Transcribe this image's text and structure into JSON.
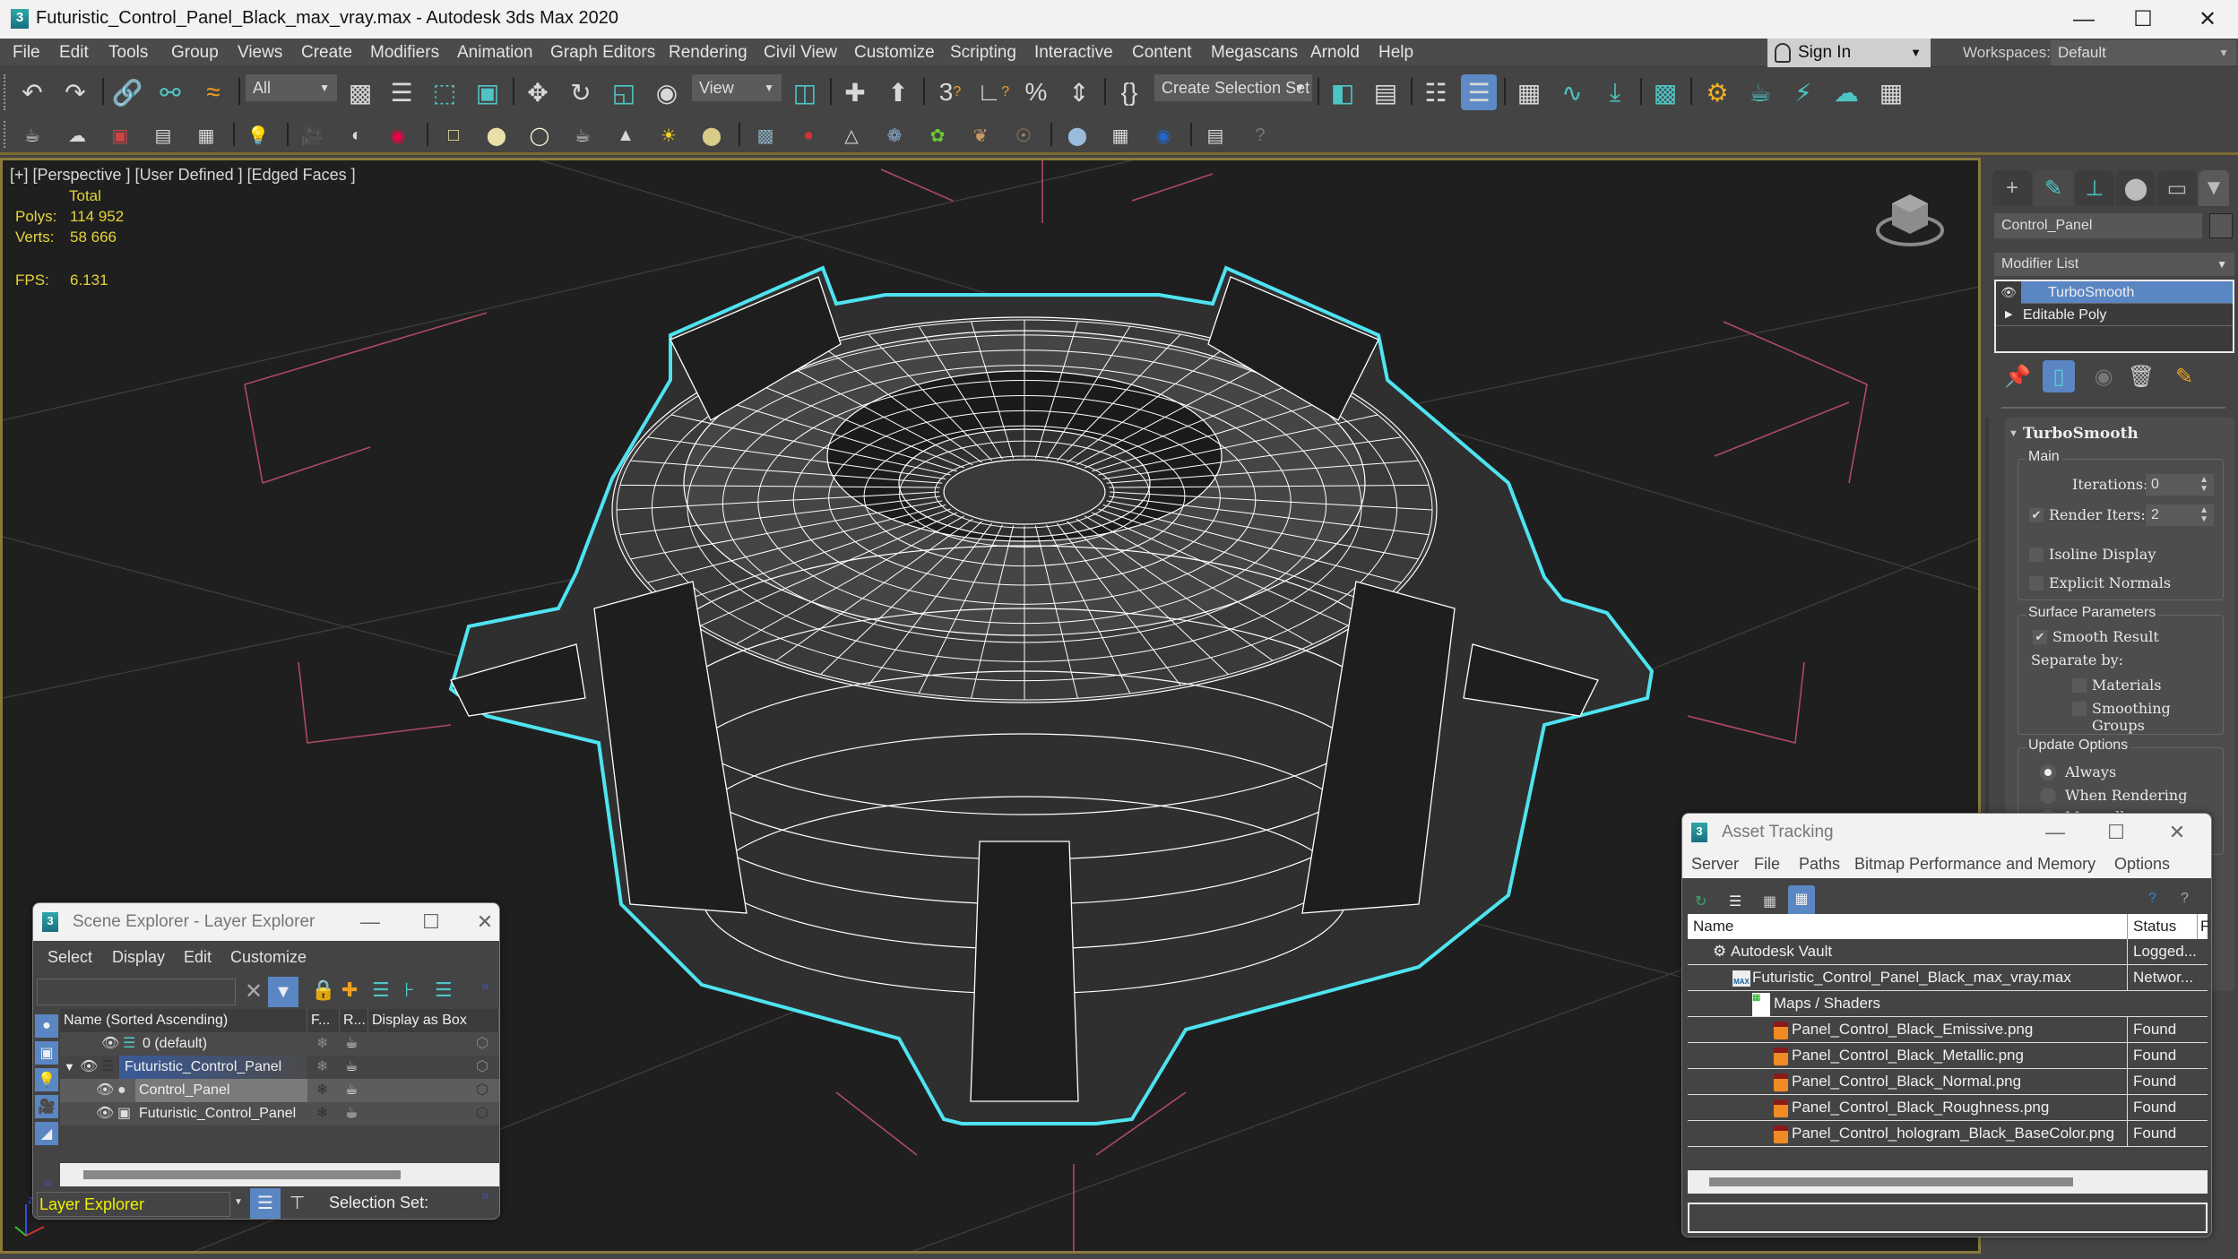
{
  "window": {
    "title": "Futuristic_Control_Panel_Black_max_vray.max - Autodesk 3ds Max 2020",
    "app_icon": "3ds-max-icon",
    "controls": [
      "minimize",
      "maximize",
      "close"
    ]
  },
  "menubar": {
    "items": [
      "File",
      "Edit",
      "Tools",
      "Group",
      "Views",
      "Create",
      "Modifiers",
      "Animation",
      "Graph Editors",
      "Rendering",
      "Civil View",
      "Customize",
      "Scripting",
      "Interactive",
      "Content",
      "Megascans",
      "Arnold",
      "Help"
    ],
    "sign_in": "Sign In",
    "workspaces_label": "Workspaces:",
    "workspaces_value": "Default"
  },
  "toolbar": {
    "selection_filter": "All",
    "reference_coord": "View",
    "selection_set": "Create Selection Set"
  },
  "viewport": {
    "label": "[+] [Perspective ] [User Defined ] [Edged Faces ]",
    "stats_header": "Total",
    "polys_label": "Polys:",
    "polys_value": "114 952",
    "verts_label": "Verts:",
    "verts_value": "58 666",
    "fps_label": "FPS:",
    "fps_value": "6.131",
    "selection_color": "#4fe3f0",
    "wire_color": "#ffffff"
  },
  "command_panel": {
    "object_name": "Control_Panel",
    "modifier_list": "Modifier List",
    "stack": [
      {
        "name": "TurboSmooth",
        "selected": true
      },
      {
        "name": "Editable Poly",
        "selected": false
      }
    ],
    "rollout": {
      "title": "TurboSmooth",
      "main_group": "Main",
      "iterations_label": "Iterations:",
      "iterations_value": "0",
      "render_iters_label": "Render Iters:",
      "render_iters_value": "2",
      "render_iters_checked": true,
      "isoline_label": "Isoline Display",
      "isoline_checked": false,
      "explicit_normals_label": "Explicit Normals",
      "explicit_normals_checked": false,
      "surface_group": "Surface Parameters",
      "smooth_result_label": "Smooth Result",
      "smooth_result_checked": true,
      "separate_by_label": "Separate by:",
      "materials_label": "Materials",
      "smoothing_groups_label": "Smoothing Groups",
      "update_group": "Update Options",
      "update_options": [
        "Always",
        "When Rendering",
        "Manually"
      ],
      "update_selected": "Always"
    }
  },
  "scene_explorer": {
    "title": "Scene Explorer - Layer Explorer",
    "menus": [
      "Select",
      "Display",
      "Edit",
      "Customize"
    ],
    "search_value": "",
    "columns": [
      "Name (Sorted Ascending)",
      "F...",
      "R...",
      "Display as Box"
    ],
    "rows": [
      {
        "name": "0 (default)",
        "type": "layer",
        "level": 0,
        "selected": false
      },
      {
        "name": "Futuristic_Control_Panel",
        "type": "layer",
        "level": 0,
        "selected": true,
        "expanded": true
      },
      {
        "name": "Control_Panel",
        "type": "object",
        "level": 1,
        "selected": false,
        "highlighted": true
      },
      {
        "name": "Futuristic_Control_Panel",
        "type": "group",
        "level": 1,
        "selected": false
      }
    ],
    "explorer_mode": "Layer Explorer",
    "selection_set_label": "Selection Set:"
  },
  "asset_tracking": {
    "title": "Asset Tracking",
    "menus": [
      "Server",
      "File",
      "Paths",
      "Bitmap Performance and Memory",
      "Options"
    ],
    "columns": [
      "Name",
      "Status",
      "F"
    ],
    "rows": [
      {
        "name": "Autodesk Vault",
        "status": "Logged...",
        "icon": "vault-icon",
        "level": 0
      },
      {
        "name": "Futuristic_Control_Panel_Black_max_vray.max",
        "status": "Networ...",
        "icon": "max-file-icon",
        "level": 1
      },
      {
        "name": "Maps / Shaders",
        "status": "",
        "icon": "maps-icon",
        "level": 2
      },
      {
        "name": "Panel_Control_Black_Emissive.png",
        "status": "Found",
        "icon": "png-icon",
        "level": 3
      },
      {
        "name": "Panel_Control_Black_Metallic.png",
        "status": "Found",
        "icon": "png-icon",
        "level": 3
      },
      {
        "name": "Panel_Control_Black_Normal.png",
        "status": "Found",
        "icon": "png-icon",
        "level": 3
      },
      {
        "name": "Panel_Control_Black_Roughness.png",
        "status": "Found",
        "icon": "png-icon",
        "level": 3
      },
      {
        "name": "Panel_Control_hologram_Black_BaseColor.png",
        "status": "Found",
        "icon": "png-icon",
        "level": 3
      }
    ],
    "path_value": ""
  }
}
